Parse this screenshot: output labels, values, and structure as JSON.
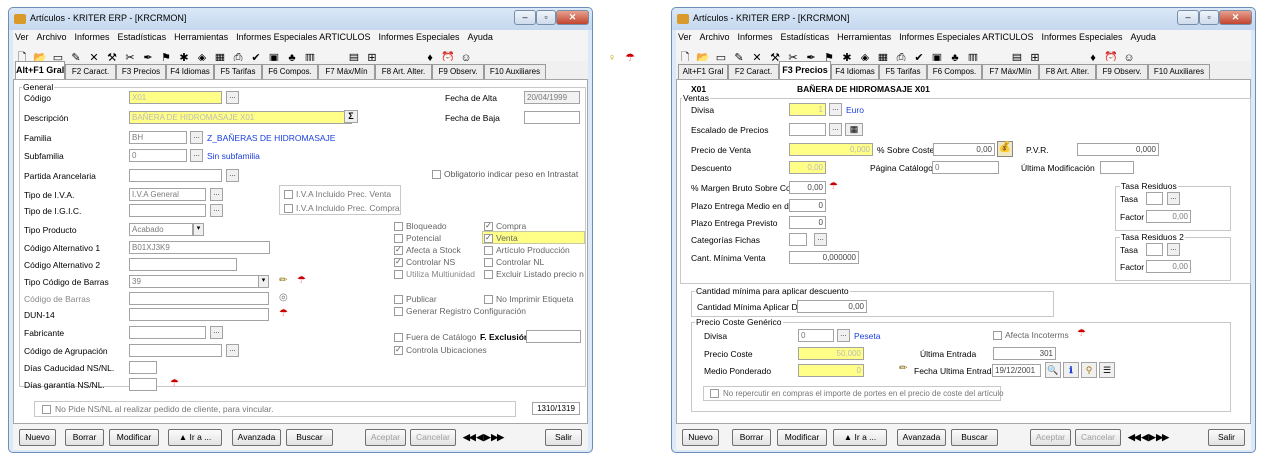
{
  "title": "Artículos - KRITER ERP - [KRCRMON]",
  "win_buttons": [
    "–",
    "▫",
    "✕"
  ],
  "menu": [
    "Ver",
    "Archivo",
    "Informes",
    "Estadísticas",
    "Herramientas",
    "Informes Especiales ARTICULOS",
    "Informes Especiales",
    "Ayuda"
  ],
  "toolbar_icons": [
    "new-doc-icon",
    "open-folder-icon",
    "save-icon",
    "edit-icon",
    "delete-icon",
    "tools-icon",
    "clip-icon",
    "pen-icon",
    "stamp-icon",
    "gear-icon",
    "component-icon",
    "calc-icon",
    "print-icon",
    "check-icon",
    "image-icon",
    "brush-icon",
    "chart-icon",
    "floppy-icon",
    "cart-icon",
    "drop-icon",
    "alarm-icon",
    "report-icon",
    "bulb-icon",
    "help-icon"
  ],
  "tabs": [
    "Alt+F1 Gral",
    "F2 Caract.",
    "F3 Precios",
    "F4 Idiomas",
    "F5 Tarifas",
    "F6 Compos.",
    "F7 Máx/Mín",
    "F8 Art. Alter.",
    "F9 Observ.",
    "F10 Auxiliares"
  ],
  "buttons": {
    "nuevo": "Nuevo",
    "borrar": "Borrar",
    "modificar": "Modificar",
    "ir": "▲ Ir a ...",
    "avanzada": "Avanzada",
    "buscar": "Buscar",
    "aceptar": "Aceptar",
    "cancelar": "Cancelar",
    "nav": "◀◀ ◀ ▶ ▶▶",
    "salir": "Salir"
  },
  "w1": {
    "general_title": "General",
    "codigo": "Código",
    "codigo_val": "X01",
    "fecha_alta": "Fecha de Alta",
    "fecha_alta_val": "20/04/1999",
    "descripcion": "Descripción",
    "descripcion_val": "BAÑERA DE HIDROMASAJE X01",
    "sigma": "Σ",
    "fecha_baja": "Fecha de Baja",
    "familia": "Familia",
    "familia_val": "BH",
    "familia_link": "Z_BAÑERAS DE HIDROMASAJE",
    "subfamilia": "Subfamilia",
    "subfamilia_val": "0",
    "subfamilia_link": "Sin subfamilia",
    "partida": "Partida Arancelaria",
    "obligatorio": "Obligatorio indicar peso en Intrastat",
    "tipo_iva": "Tipo de I.V.A.",
    "tipo_iva_val": "I.V.A General",
    "iva_incl_venta": "I.V.A Incluido Prec. Venta",
    "tipo_igic": "Tipo de I.G.I.C.",
    "iva_incl_compra": "I.V.A Incluido Prec. Compra",
    "tipo_producto": "Tipo Producto",
    "tipo_producto_val": "Acabado",
    "cod_alt1": "Código Alternativo 1",
    "cod_alt1_val": "B01XJ3K9",
    "cod_alt2": "Código Alternativo 2",
    "tipo_barras": "Tipo Código de Barras",
    "tipo_barras_val": "39",
    "cod_barras": "Código de Barras",
    "dun14": "DUN-14",
    "fabricante": "Fabricante",
    "cod_agrup": "Código de Agrupación",
    "dias_cad": "Días Caducidad NS/NL.",
    "dias_gar": "Días garantía NS/NL.",
    "checks_left": [
      "Bloqueado",
      "Potencial",
      "Afecta a Stock",
      "Controlar NS",
      "Utiliza Multiunidad"
    ],
    "checks_right": [
      "Compra",
      "Venta",
      "Artículo Producción",
      "Controlar NL",
      "Excluir Listado precio n"
    ],
    "publicar": "Publicar",
    "no_imprimir": "No Imprimir Etiqueta",
    "gen_registro": "Generar Registro Configuración",
    "fuera_catalogo": "Fuera de Catálogo",
    "f_exclusion": "F. Exclusión",
    "controla_ubic": "Controla Ubicaciones",
    "no_pide": "No Pide NS/NL al realizar pedido de cliente, para vincular.",
    "counter": "1310/1319"
  },
  "w2": {
    "code": "X01",
    "desc": "BAÑERA DE HIDROMASAJE X01",
    "ventas": "Ventas",
    "divisa": "Divisa",
    "divisa_val": "1",
    "divisa_link": "Euro",
    "escalado": "Escalado de Precios",
    "precio_venta": "Precio de Venta",
    "precio_venta_val": "0,000",
    "sobre_coste": "% Sobre Coste",
    "sobre_coste_val": "0,00",
    "pvr": "P.V.R.",
    "pvr_val": "0,000",
    "descuento": "Descuento",
    "descuento_val": "0,00",
    "pag_catalogo": "Página Catálogo",
    "pag_catalogo_val": "0",
    "ult_mod": "Última Modificación",
    "margen": "% Margen Bruto Sobre Coste",
    "margen_val": "0,00",
    "plazo_medio": "Plazo Entrega Medio en días",
    "plazo_medio_val": "0",
    "plazo_prev": "Plazo Entrega Previsto",
    "plazo_prev_val": "0",
    "categorias": "Categorías Fichas",
    "cant_min": "Cant. Mínima Venta",
    "cant_min_val": "0,000000",
    "tasa_res": "Tasa Residuos",
    "tasa": "Tasa",
    "factor": "Factor",
    "factor_val": "0,00",
    "tasa_res2": "Tasa Residuos 2",
    "factor2_val": "0,00",
    "cant_dto_title": "Cantidad mínima para aplicar descuento",
    "cant_dto": "Cantidad Mínima Aplicar Dto",
    "cant_dto_val": "0,00",
    "pcg": "Precio Coste Genérico",
    "divisa2": "Divisa",
    "divisa2_val": "0",
    "divisa2_link": "Peseta",
    "afecta_inc": "Afecta Incoterms",
    "precio_coste": "Precio Coste",
    "precio_coste_val": "50,000",
    "ult_entrada": "Última Entrada",
    "ult_entrada_val": "301",
    "medio_pond": "Medio Ponderado",
    "medio_pond_val": "0",
    "fecha_ult": "Fecha Ultima Entrada",
    "fecha_ult_val": "19/12/2001",
    "no_repercutir": "No repercutir en compras el importe de portes en el precio de coste del artículo"
  }
}
